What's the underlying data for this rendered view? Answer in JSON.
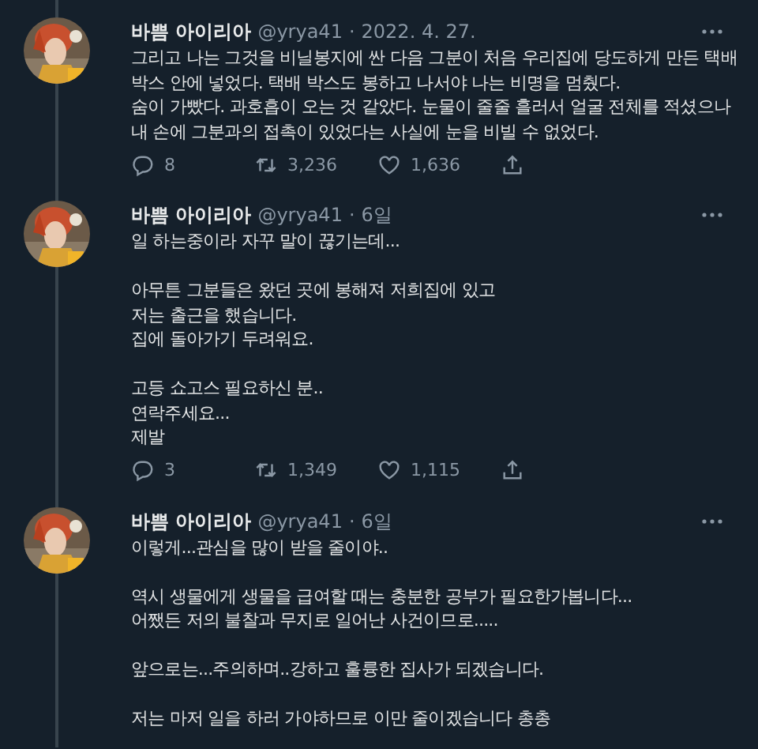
{
  "separator": "·",
  "tweets": [
    {
      "name": "바쁨 아이리아",
      "handle": "@yrya41",
      "time": "2022. 4. 27.",
      "body": "그리고 나는 그것을 비닐봉지에 싼 다음 그분이 처음 우리집에 당도하게 만든 택배\n박스 안에 넣었다. 택배 박스도 봉하고 나서야 나는 비명을 멈췄다.\n숨이 가빴다. 과호흡이 오는 것 같았다. 눈물이 줄줄 흘러서 얼굴 전체를 적셨으나\n내 손에 그분과의 접촉이 있었다는 사실에 눈을 비빌 수 없었다.",
      "actions": {
        "replies": "8",
        "retweets": "3,236",
        "likes": "1,636"
      }
    },
    {
      "name": "바쁨 아이리아",
      "handle": "@yrya41",
      "time": "6일",
      "body": "일 하는중이라 자꾸 말이 끊기는데...\n\n아무튼 그분들은 왔던 곳에 봉해져 저희집에 있고\n저는 출근을 했습니다.\n집에 돌아가기 두려워요.\n\n고등 쇼고스 필요하신 분..\n연락주세요...\n제발",
      "actions": {
        "replies": "3",
        "retweets": "1,349",
        "likes": "1,115"
      }
    },
    {
      "name": "바쁨 아이리아",
      "handle": "@yrya41",
      "time": "6일",
      "body": "이렇게...관심을 많이 받을 줄이야..\n\n역시 생물에게 생물을 급여할 때는 충분한 공부가 필요한가봅니다...\n어쨌든 저의 불찰과 무지로 일어난 사건이므로.....\n\n앞으로는...주의하며..강하고 훌륭한 집사가 되겠습니다.\n\n저는 마저 일을 하러 가야하므로 이만 줄이겠습니다 총총"
    }
  ]
}
